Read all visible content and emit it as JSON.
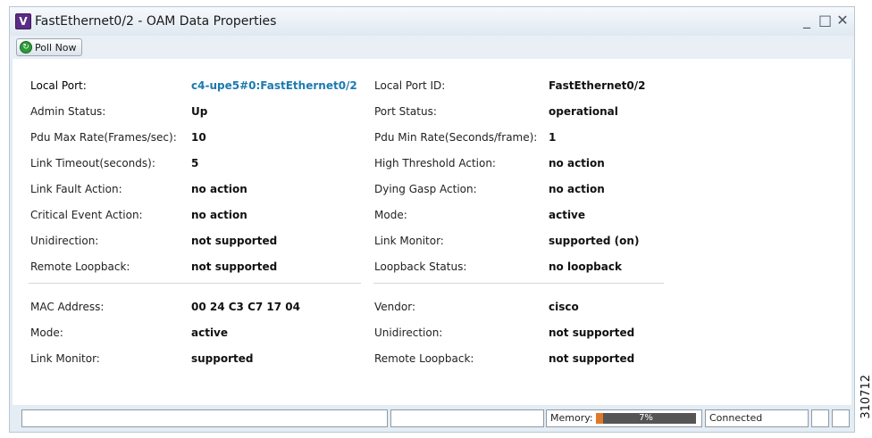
{
  "window": {
    "app_icon_letter": "V",
    "title": "FastEthernet0/2 - OAM Data Properties",
    "minimize_glyph": "_",
    "maximize_glyph": "□",
    "close_glyph": "✕"
  },
  "toolbar": {
    "poll_label": "Poll Now",
    "poll_icon": "refresh-icon"
  },
  "local": [
    {
      "label": "Local Port:",
      "value": "c4-upe5#0:FastEthernet0/2",
      "is_link": true
    },
    {
      "label": "Admin Status:",
      "value": "Up"
    },
    {
      "label": "Pdu Max Rate(Frames/sec):",
      "value": "10"
    },
    {
      "label": "Link Timeout(seconds):",
      "value": "5"
    },
    {
      "label": "Link Fault Action:",
      "value": "no action"
    },
    {
      "label": "Critical Event Action:",
      "value": "no action"
    },
    {
      "label": "Unidirection:",
      "value": "not supported"
    },
    {
      "label": "Remote Loopback:",
      "value": "not supported"
    }
  ],
  "local_right": [
    {
      "label": "Local Port ID:",
      "value": "FastEthernet0/2"
    },
    {
      "label": "Port Status:",
      "value": "operational"
    },
    {
      "label": "Pdu Min Rate(Seconds/frame):",
      "value": "1"
    },
    {
      "label": "High Threshold Action:",
      "value": "no action"
    },
    {
      "label": "Dying Gasp Action:",
      "value": "no action"
    },
    {
      "label": "Mode:",
      "value": "active"
    },
    {
      "label": "Link Monitor:",
      "value": "supported (on)"
    },
    {
      "label": "Loopback Status:",
      "value": "no loopback"
    }
  ],
  "remote": [
    {
      "label": "MAC Address:",
      "value": "00 24 C3 C7 17 04"
    },
    {
      "label": "Mode:",
      "value": "active"
    },
    {
      "label": "Link Monitor:",
      "value": "supported"
    }
  ],
  "remote_right": [
    {
      "label": "Vendor:",
      "value": "cisco"
    },
    {
      "label": "Unidirection:",
      "value": "not supported"
    },
    {
      "label": "Remote Loopback:",
      "value": "not supported"
    }
  ],
  "statusbar": {
    "memory_label": "Memory:",
    "memory_percent_text": "7%",
    "memory_fraction": 0.07,
    "connection": "Connected"
  },
  "figure_number": "310712",
  "colors": {
    "link": "#1b7ab0",
    "memory_fill": "#e0782a",
    "memory_track": "#555555"
  }
}
